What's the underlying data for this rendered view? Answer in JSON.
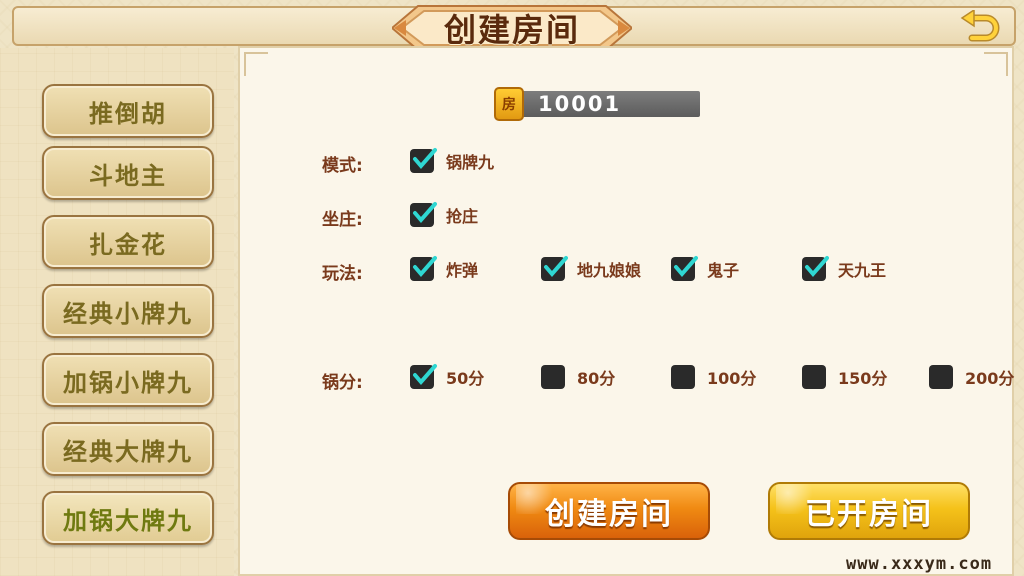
{
  "header": {
    "title": "创建房间"
  },
  "sidebar": {
    "items": [
      {
        "label": "推倒胡"
      },
      {
        "label": "斗地主"
      },
      {
        "label": "扎金花"
      },
      {
        "label": "经典小牌九"
      },
      {
        "label": "加锅小牌九"
      },
      {
        "label": "经典大牌九"
      },
      {
        "label": "加锅大牌九"
      }
    ]
  },
  "room": {
    "icon_char": "房",
    "number": "10001"
  },
  "settings": {
    "mode": {
      "label": "模式:",
      "options": [
        {
          "text": "锅牌九",
          "checked": true
        }
      ]
    },
    "banker": {
      "label": "坐庄:",
      "options": [
        {
          "text": "抢庄",
          "checked": true
        }
      ]
    },
    "play": {
      "label": "玩法:",
      "options": [
        {
          "text": "炸弹",
          "checked": true
        },
        {
          "text": "地九娘娘",
          "checked": true
        },
        {
          "text": "鬼子",
          "checked": true
        },
        {
          "text": "天九王",
          "checked": true
        }
      ]
    },
    "pot": {
      "label": "锅分:",
      "options": [
        {
          "text": "50分",
          "checked": true
        },
        {
          "text": "80分",
          "checked": false
        },
        {
          "text": "100分",
          "checked": false
        },
        {
          "text": "150分",
          "checked": false
        },
        {
          "text": "200分",
          "checked": false
        }
      ]
    }
  },
  "buttons": {
    "create": "创建房间",
    "opened": "已开房间"
  },
  "watermark": "www.xxxym.com",
  "colors": {
    "accent_orange": "#f08a12",
    "accent_yellow": "#f5c21a",
    "check": "#2fd7d2",
    "label_text": "#7a3a1c"
  }
}
